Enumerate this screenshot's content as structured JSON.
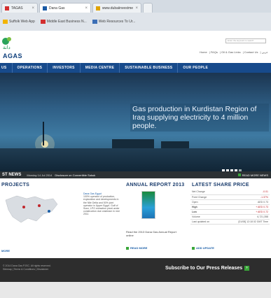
{
  "browser": {
    "tabs": [
      {
        "label": "TAGAS"
      },
      {
        "label": "Dana Gas"
      },
      {
        "label": "www.dubaiinvestments.com"
      }
    ],
    "bookmarks": [
      {
        "label": "Suffolk Web App"
      },
      {
        "label": "Middle East Business N..."
      },
      {
        "label": "Web Resources To Ur..."
      }
    ]
  },
  "header": {
    "logo_arabic": "دانة",
    "logo_text": "AGAS",
    "search_placeholder": "Enter the keyword to search",
    "toplinks": [
      "Home",
      "FAQs",
      "Oil & Gas Links",
      "Contact Us",
      "عربي"
    ]
  },
  "nav": {
    "items": [
      "US",
      "OPERATIONS",
      "INVESTORS",
      "MEDIA CENTRE",
      "SUSTAINABLE BUSINESS",
      "OUR PEOPLE"
    ]
  },
  "hero": {
    "text": "Gas production in Kurdistan Region of Iraq supplying electricity to 4 million people."
  },
  "news": {
    "label": "ST NEWS",
    "date": "Monday 14 Jul 2014",
    "headline": "Disclosure on Convertible Sukuk",
    "more": "READ MORE NEWS"
  },
  "projects": {
    "title": "PROJECTS",
    "desc_head": "Dana Gas Egypt",
    "desc": "100% operator of production, exploration and developments in the Nile Delta and 50% joint operator in Upper Egypt. Gulf of Suez, LPG extraction plant under construction due onstream in mid 2011",
    "more": "MORE"
  },
  "annual": {
    "title": "ANNUAL REPORT 2013",
    "desc": "Read the 2013 Dana Gas Annual Report online",
    "more": "READ MORE"
  },
  "share": {
    "title": "LATEST SHARE PRICE",
    "rows": [
      {
        "label": "Net Change",
        "value": "-0.01"
      },
      {
        "label": "Point Change",
        "value": "-1.37%"
      },
      {
        "label": "Open",
        "value": "AED 0.73"
      },
      {
        "label": "High",
        "value": "+ AED 0.73"
      },
      {
        "label": "Low",
        "value": "+ AED 0.72"
      },
      {
        "label": "Volume",
        "value": "6,721,358"
      },
      {
        "label": "Last updated on",
        "value": "[01/08] 12:18 02 GMT Time"
      }
    ],
    "more": "ADD UPDATE"
  },
  "footer": {
    "copyright": "© 2014 Dana Gas PJSC. All rights reserved.",
    "links": "Sitemap | Terms & Conditions | Disclaimer",
    "subscribe": "Subscribe to Our Press Releases"
  },
  "colors": {
    "nav": "#174a8b",
    "accent_green": "#3aa63a",
    "footer": "#2d2d2d"
  }
}
